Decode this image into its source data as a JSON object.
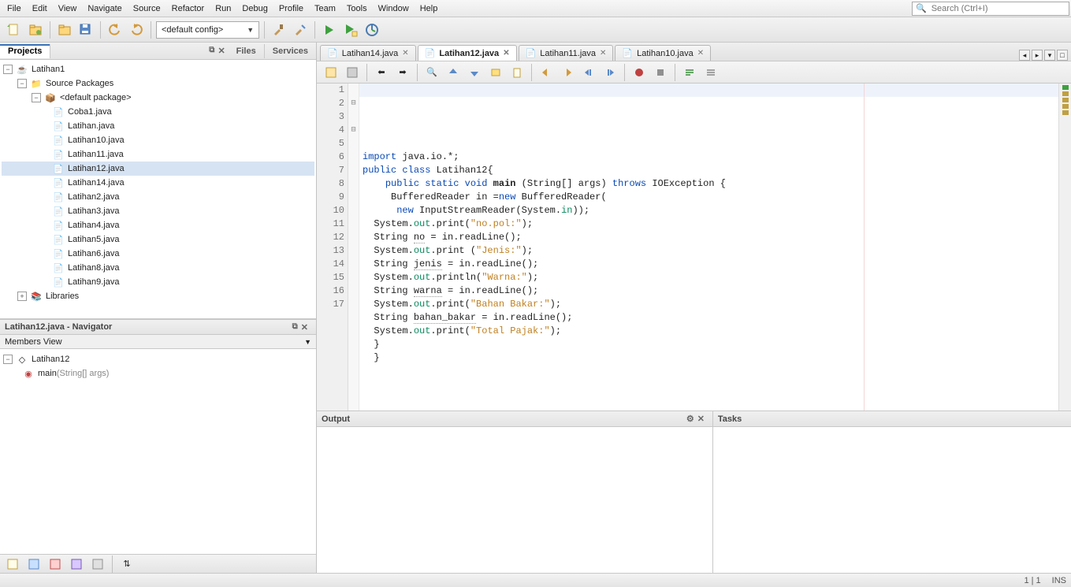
{
  "menu": [
    "File",
    "Edit",
    "View",
    "Navigate",
    "Source",
    "Refactor",
    "Run",
    "Debug",
    "Profile",
    "Team",
    "Tools",
    "Window",
    "Help"
  ],
  "search_placeholder": "Search (Ctrl+I)",
  "config_combo": "<default config>",
  "left_tabs": {
    "projects": "Projects",
    "files": "Files",
    "services": "Services"
  },
  "project": {
    "name": "Latihan1",
    "source_pkg": "Source Packages",
    "default_pkg": "<default package>",
    "files": [
      "Coba1.java",
      "Latihan.java",
      "Latihan10.java",
      "Latihan11.java",
      "Latihan12.java",
      "Latihan14.java",
      "Latihan2.java",
      "Latihan3.java",
      "Latihan4.java",
      "Latihan5.java",
      "Latihan6.java",
      "Latihan8.java",
      "Latihan9.java"
    ],
    "libraries": "Libraries"
  },
  "navigator": {
    "title": "Latihan12.java - Navigator",
    "members_view": "Members View",
    "class": "Latihan12",
    "method": "main",
    "method_args": "(String[] args)"
  },
  "editor_tabs": [
    "Latihan14.java",
    "Latihan12.java",
    "Latihan11.java",
    "Latihan10.java"
  ],
  "editor_active_index": 1,
  "code_lines": [
    {
      "n": 1,
      "fold": "",
      "html": ""
    },
    {
      "n": 2,
      "fold": "⊟",
      "html": "<span class='kw'>import</span> java.io.*;"
    },
    {
      "n": 3,
      "fold": "",
      "html": "<span class='kw'>public</span> <span class='kw'>class</span> Latihan12{"
    },
    {
      "n": 4,
      "fold": "⊟",
      "html": "    <span class='kw'>public</span> <span class='kw'>static</span> <span class='kw'>void</span> <b>main</b> (String[] args) <span class='kw'>throws</span> IOException {"
    },
    {
      "n": 5,
      "fold": "",
      "html": "     BufferedReader in =<span class='kw'>new</span> BufferedReader("
    },
    {
      "n": 6,
      "fold": "",
      "html": "      <span class='kw'>new</span> InputStreamReader(System.<span class='field'>in</span>));"
    },
    {
      "n": 7,
      "fold": "",
      "html": "  System.<span class='field'>out</span>.print(<span class='str'>\"no.pol:\"</span>);"
    },
    {
      "n": 8,
      "fold": "",
      "html": "  String <span class='und'>no</span> = in.readLine();"
    },
    {
      "n": 9,
      "fold": "",
      "html": "  System.<span class='field'>out</span>.print (<span class='str'>\"Jenis:\"</span>);"
    },
    {
      "n": 10,
      "fold": "",
      "html": "  String <span class='und'>jenis</span> = in.readLine();"
    },
    {
      "n": 11,
      "fold": "",
      "html": "  System.<span class='field'>out</span>.println(<span class='str'>\"Warna:\"</span>);"
    },
    {
      "n": 12,
      "fold": "",
      "html": "  String <span class='und'>warna</span> = in.readLine();"
    },
    {
      "n": 13,
      "fold": "",
      "html": "  System.<span class='field'>out</span>.print(<span class='str'>\"Bahan Bakar:\"</span>);"
    },
    {
      "n": 14,
      "fold": "",
      "html": "  String <span class='und'>bahan_bakar</span> = in.readLine();"
    },
    {
      "n": 15,
      "fold": "",
      "html": "  System.<span class='field'>out</span>.print(<span class='str'>\"Total Pajak:\"</span>);"
    },
    {
      "n": 16,
      "fold": "",
      "html": "  }"
    },
    {
      "n": 17,
      "fold": "",
      "html": "  }"
    }
  ],
  "output_title": "Output",
  "tasks_title": "Tasks",
  "status": {
    "pos": "1 | 1",
    "mode": "INS"
  }
}
